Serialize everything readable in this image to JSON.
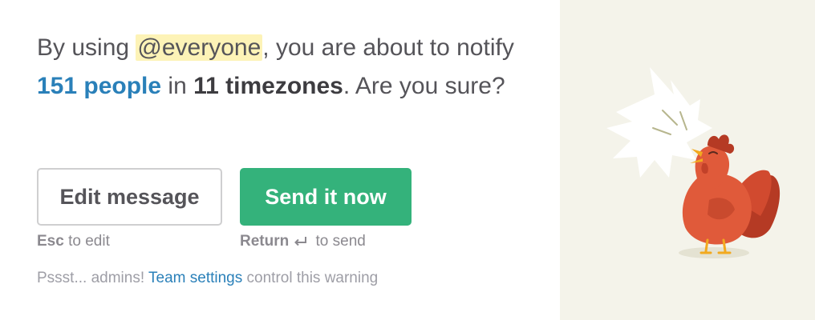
{
  "message": {
    "prefix": "By using ",
    "mention": "@everyone",
    "middle1": ", you are about to notify ",
    "people": "151 people",
    "middle2": " in ",
    "timezones": "11 timezones",
    "suffix": ". Are you sure?"
  },
  "buttons": {
    "edit_label": "Edit message",
    "send_label": "Send it now"
  },
  "hints": {
    "edit_key": "Esc",
    "edit_text": " to edit",
    "send_key": "Return",
    "send_text": " to send"
  },
  "footer": {
    "prefix": "Pssst... admins! ",
    "link": "Team settings",
    "suffix": " control this warning"
  },
  "illustration": {
    "icon": "rooster-crowing-icon"
  },
  "colors": {
    "send_button": "#34b27b",
    "link": "#2a80b9",
    "mention_highlight": "#fdf3b7",
    "illustration_bg": "#f4f3ea",
    "rooster_body": "#e05a3a"
  }
}
